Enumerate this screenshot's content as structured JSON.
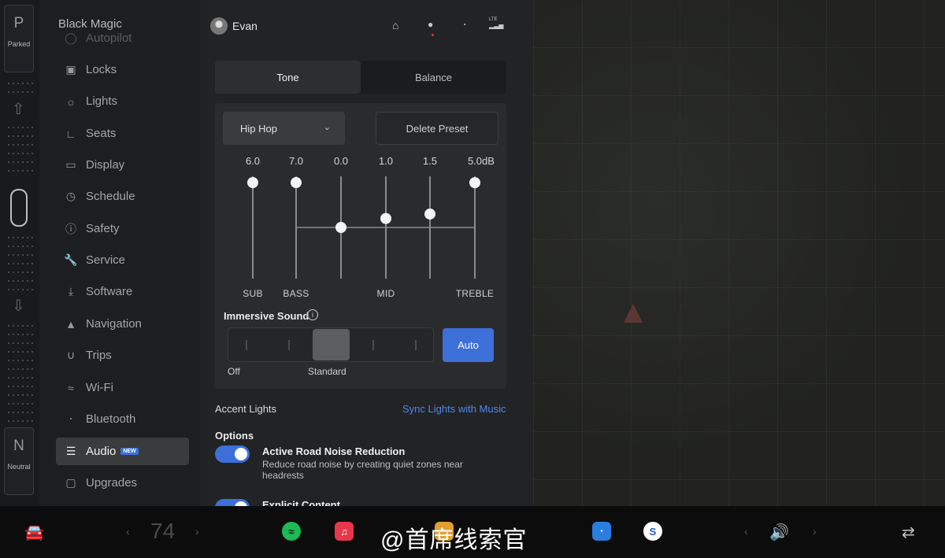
{
  "gear": {
    "top_letter": "P",
    "top_state": "Parked",
    "bottom_letter": "N",
    "bottom_state": "Neutral"
  },
  "sidebar": {
    "car_name": "Black Magic",
    "items": [
      {
        "label": "Autopilot",
        "icon": "steering-icon"
      },
      {
        "label": "Locks",
        "icon": "lock-icon"
      },
      {
        "label": "Lights",
        "icon": "sun-icon"
      },
      {
        "label": "Seats",
        "icon": "seat-icon"
      },
      {
        "label": "Display",
        "icon": "display-icon"
      },
      {
        "label": "Schedule",
        "icon": "clock-icon"
      },
      {
        "label": "Safety",
        "icon": "safety-icon"
      },
      {
        "label": "Service",
        "icon": "wrench-icon"
      },
      {
        "label": "Software",
        "icon": "download-icon"
      },
      {
        "label": "Navigation",
        "icon": "navigation-icon"
      },
      {
        "label": "Trips",
        "icon": "trips-icon"
      },
      {
        "label": "Wi-Fi",
        "icon": "wifi-icon"
      },
      {
        "label": "Bluetooth",
        "icon": "bluetooth-icon"
      },
      {
        "label": "Audio",
        "icon": "equalizer-icon",
        "badge": "NEW",
        "active": true
      },
      {
        "label": "Upgrades",
        "icon": "bag-icon"
      }
    ]
  },
  "topbar": {
    "user_name": "Evan",
    "signal_label": "LTE"
  },
  "tabs": [
    {
      "label": "Tone",
      "active": true
    },
    {
      "label": "Balance",
      "active": false
    }
  ],
  "equalizer": {
    "preset": "Hip Hop",
    "delete_label": "Delete Preset",
    "unit": "dB",
    "bands": [
      {
        "value": "6.0",
        "level": 6.0,
        "label": "SUB"
      },
      {
        "value": "7.0",
        "level": 7.0,
        "label": "BASS"
      },
      {
        "value": "0.0",
        "level": 0.0,
        "label": ""
      },
      {
        "value": "1.0",
        "level": 1.0,
        "label": "MID"
      },
      {
        "value": "1.5",
        "level": 1.5,
        "label": ""
      },
      {
        "value": "5.0",
        "level": 5.0,
        "label": "TREBLE"
      }
    ],
    "range": [
      -12,
      12
    ]
  },
  "immersive": {
    "label": "Immersive Sound",
    "auto_label": "Auto",
    "off_label": "Off",
    "standard_label": "Standard",
    "selected_step": 2
  },
  "accent": {
    "label": "Accent Lights",
    "link": "Sync Lights with Music"
  },
  "options": {
    "header": "Options",
    "items": [
      {
        "title": "Active Road Noise Reduction",
        "desc": "Reduce road noise by creating quiet zones near headrests",
        "on": true
      },
      {
        "title": "Explicit Content",
        "on": true
      }
    ]
  },
  "bottombar": {
    "temperature": "74",
    "watermark": "@首席线索官"
  },
  "colors": {
    "accent": "#3d6fd9",
    "link": "#4d86f5"
  }
}
